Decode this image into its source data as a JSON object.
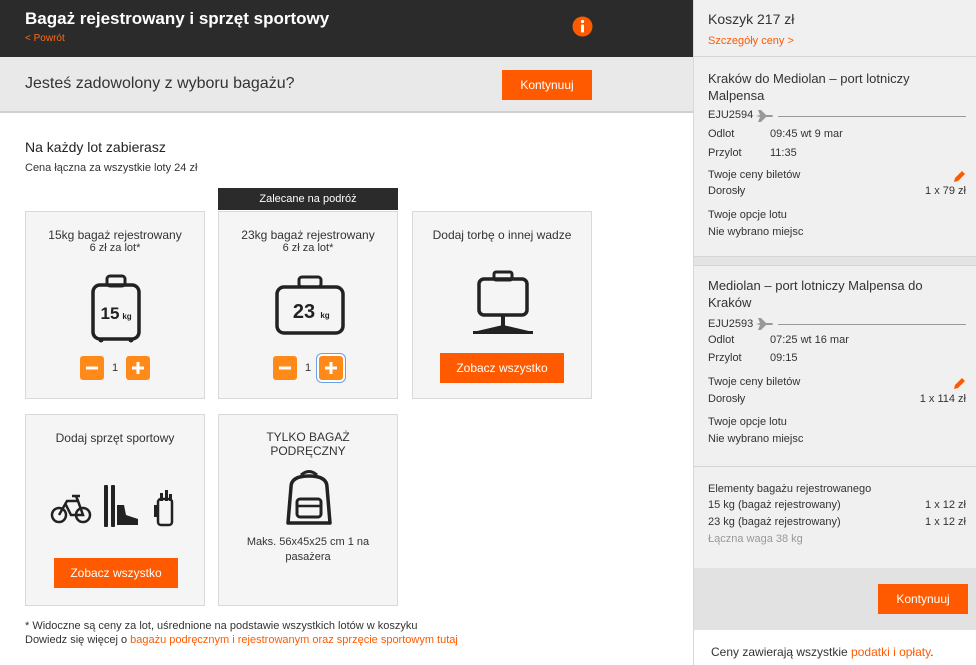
{
  "header": {
    "title": "Bagaż rejestrowany i sprzęt sportowy",
    "back_label": "< Powrót"
  },
  "question_bar": {
    "text": "Jesteś zadowolony z wyboru bagażu?",
    "continue_label": "Kontynuuj"
  },
  "intro": {
    "heading": "Na każdy lot zabierasz",
    "total": "Cena łączna za wszystkie loty 24 zł"
  },
  "recommended_label": "Zalecane na podróż",
  "cards": {
    "bag15": {
      "title": "15kg bagaż rejestrowany",
      "price": "6 zł za lot*",
      "weight": "15",
      "unit": "kg",
      "quantity": "1"
    },
    "bag23": {
      "title": "23kg bagaż rejestrowany",
      "price": "6 zł za lot*",
      "weight": "23",
      "unit": "kg",
      "quantity": "1"
    },
    "other": {
      "title": "Dodaj torbę o innej wadze",
      "button": "Zobacz wszystko"
    },
    "sports": {
      "title": "Dodaj sprzęt sportowy",
      "button": "Zobacz wszystko"
    },
    "hand": {
      "title": "TYLKO BAGAŻ PODRĘCZNY",
      "note": "Maks. 56x45x25 cm 1 na pasażera"
    }
  },
  "footnote": {
    "line1": "* Widoczne są ceny za lot, uśrednione na podstawie wszystkich lotów w koszyku",
    "line2_prefix": "Dowiedz się więcej o ",
    "line2_link": "bagażu podręcznym i rejestrowanym oraz sprzęcie sportowym tutaj"
  },
  "basket": {
    "title": "Koszyk 217 zł",
    "details_link": "Szczegóły ceny >",
    "flights": [
      {
        "route": "Kraków do Mediolan – port lotniczy Malpensa",
        "code": "EJU2594",
        "depart_label": "Odlot",
        "depart_value": "09:45 wt 9 mar",
        "arrive_label": "Przylot",
        "arrive_value": "11:35",
        "prices_label": "Twoje ceny biletów",
        "passenger": "Dorosły",
        "passenger_price": "1 x 79 zł",
        "options_label": "Twoje opcje lotu",
        "options_value": "Nie wybrano miejsc"
      },
      {
        "route": "Mediolan – port lotniczy Malpensa do Kraków",
        "code": "EJU2593",
        "depart_label": "Odlot",
        "depart_value": "07:25 wt 16 mar",
        "arrive_label": "Przylot",
        "arrive_value": "09:15",
        "prices_label": "Twoje ceny biletów",
        "passenger": "Dorosły",
        "passenger_price": "1 x 114 zł",
        "options_label": "Twoje opcje lotu",
        "options_value": "Nie wybrano miejsc"
      }
    ],
    "baggage": {
      "heading": "Elementy bagażu rejestrowanego",
      "items": [
        {
          "name": "15 kg (bagaż rejestrowany)",
          "price": "1 x 12 zł"
        },
        {
          "name": "23 kg (bagaż rejestrowany)",
          "price": "1 x 12 zł"
        }
      ],
      "total_weight": "Łączna waga 38 kg"
    },
    "continue_label": "Kontynuuj",
    "footer_prefix": "Ceny zawierają wszystkie ",
    "footer_link": "podatki i opłaty",
    "footer_suffix": "."
  },
  "colors": {
    "accent": "#ff5a00",
    "header_bg": "#2b2b2b"
  }
}
